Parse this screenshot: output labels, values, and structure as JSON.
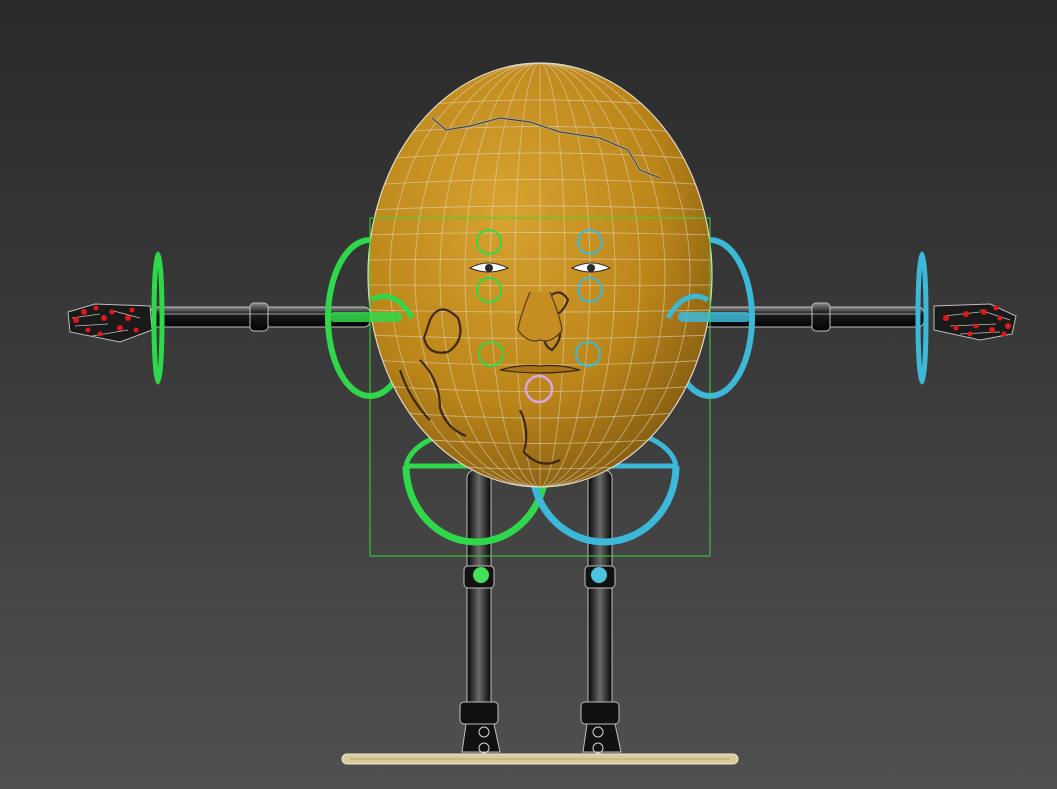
{
  "viewport": {
    "background_top": "#2a2a2a",
    "background_bottom": "#505050"
  },
  "character": {
    "name_visible": "",
    "skin_color": "#c7901f",
    "skin_shadow": "#7a5510",
    "wire_color": "#d8d2c2",
    "bone_color": "#111111",
    "bone_highlight": "#9a9a9a"
  },
  "controls": {
    "left_color": "#2fd84a",
    "right_color": "#3cb8d8",
    "mouth_color": "#d8a6e6",
    "bounding_box_color": "#38d838",
    "hand_marker_color": "#e01818",
    "ground_plate_color": "#e8dcae"
  }
}
